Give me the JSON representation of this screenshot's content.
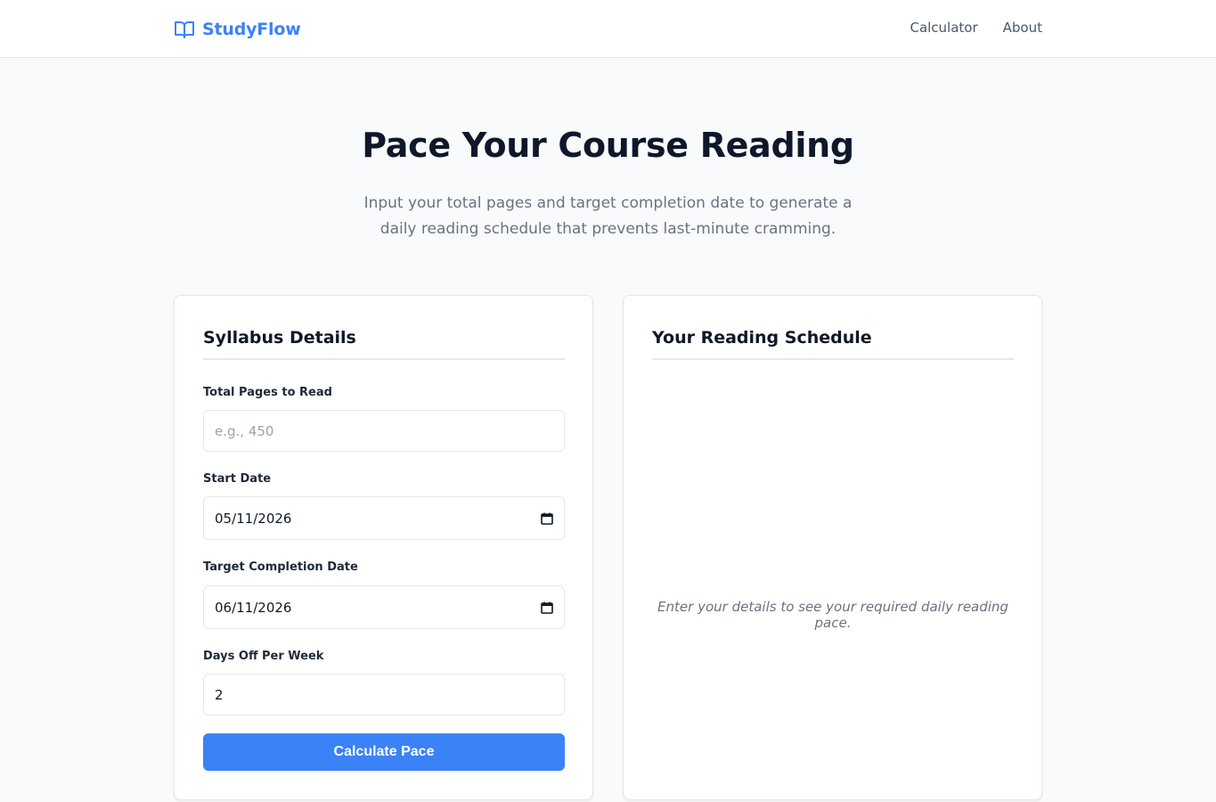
{
  "brand": {
    "name": "StudyFlow",
    "icon": "open-book-icon",
    "color": "#3b82f6"
  },
  "nav": {
    "links": [
      "Calculator",
      "About"
    ]
  },
  "hero": {
    "title": "Pace Your Course Reading",
    "subtitle": "Input your total pages and target completion date to generate a daily reading schedule that prevents last-minute cramming."
  },
  "form": {
    "title": "Syllabus Details",
    "total_pages": {
      "label": "Total Pages to Read",
      "placeholder": "e.g., 450",
      "value": ""
    },
    "start_date": {
      "label": "Start Date",
      "value": "05/11/2026",
      "icon": "calendar-icon"
    },
    "target_date": {
      "label": "Target Completion Date",
      "value": "06/11/2026",
      "icon": "calendar-icon"
    },
    "days_off": {
      "label": "Days Off Per Week",
      "value": "2"
    },
    "submit_label": "Calculate Pace",
    "accent": "#3b82f6"
  },
  "schedule": {
    "title": "Your Reading Schedule",
    "empty_message": "Enter your details to see your required daily reading pace."
  }
}
